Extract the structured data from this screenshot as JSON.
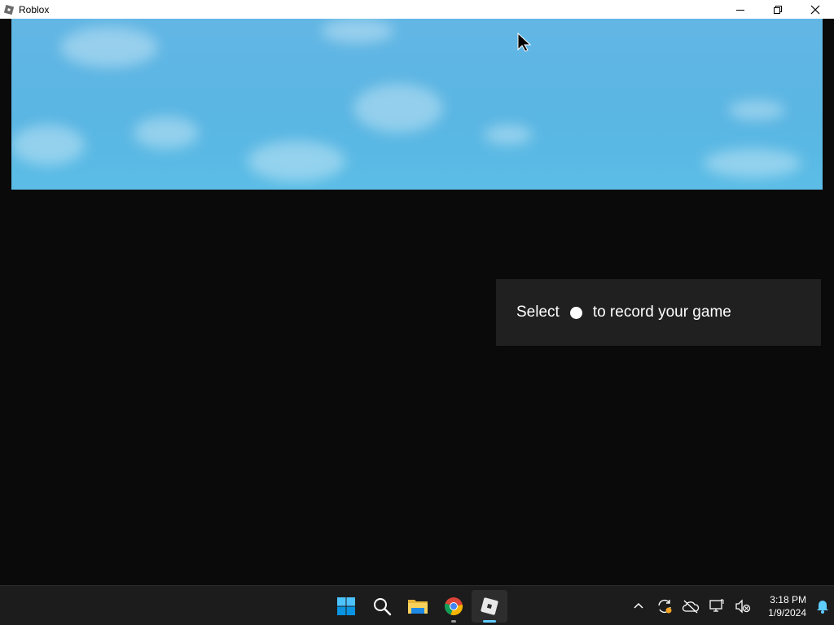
{
  "window": {
    "title": "Roblox",
    "icon": "roblox-icon",
    "controls": [
      "minimize-icon",
      "restore-icon",
      "close-icon"
    ]
  },
  "game": {
    "toast": {
      "prefix": "Select",
      "icon": "record-dot-icon",
      "suffix": "to record your game"
    }
  },
  "taskbar": {
    "apps": [
      {
        "name": "start",
        "icon": "windows-start-icon"
      },
      {
        "name": "search",
        "icon": "search-icon"
      },
      {
        "name": "file-explorer",
        "icon": "folder-icon"
      },
      {
        "name": "chrome",
        "icon": "chrome-icon",
        "running": true
      },
      {
        "name": "roblox",
        "icon": "roblox-icon",
        "running": true,
        "active": true
      }
    ],
    "tray": [
      "chevron-up-icon",
      "sync-icon",
      "cloud-off-icon",
      "network-icon",
      "volume-muted-icon"
    ],
    "time": "3:18 PM",
    "date": "1/9/2024",
    "notification_icon": "bell-icon",
    "colors": {
      "accent": "#60cdff",
      "background": "#1c1c1c"
    }
  }
}
